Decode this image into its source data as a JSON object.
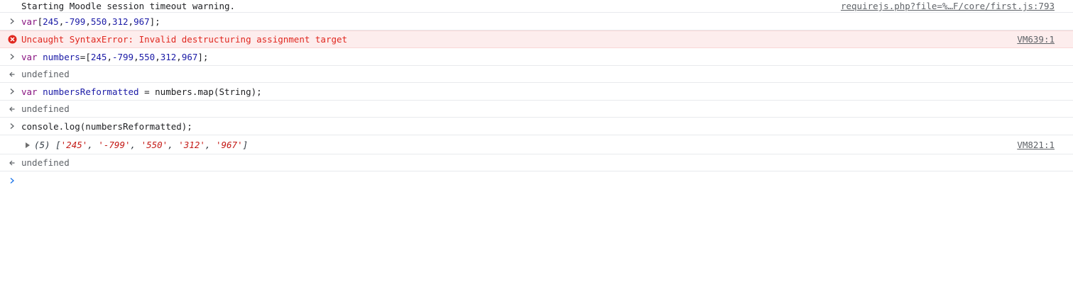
{
  "console": {
    "entries": [
      {
        "kind": "log",
        "text": "Starting Moodle session timeout warning.",
        "source": "requirejs.php?file=%…F/core/first.js:793"
      },
      {
        "kind": "input",
        "text_parts": [
          "var",
          "[",
          "245",
          ",",
          "-799",
          ",",
          "550",
          ",",
          "312",
          ",",
          "967",
          "];"
        ]
      },
      {
        "kind": "error",
        "icon": "error-circle-icon",
        "text": "Uncaught SyntaxError: Invalid destructuring assignment target",
        "source": "VM639:1"
      },
      {
        "kind": "input",
        "text_parts": [
          "var",
          " ",
          "numbers",
          "=[",
          "245",
          ",",
          "-799",
          ",",
          "550",
          ",",
          "312",
          ",",
          "967",
          "];"
        ]
      },
      {
        "kind": "result",
        "text": "undefined"
      },
      {
        "kind": "input",
        "text_parts": [
          "var",
          " ",
          "numbersReformatted",
          " = numbers.map(String);"
        ]
      },
      {
        "kind": "result",
        "text": "undefined"
      },
      {
        "kind": "input",
        "text": "console.log(numbersReformatted);"
      },
      {
        "kind": "array-log",
        "count": "(5)",
        "open": "[",
        "items": [
          "'245'",
          "'-799'",
          "'550'",
          "'312'",
          "'967'"
        ],
        "close": "]",
        "source": "VM821:1"
      },
      {
        "kind": "result",
        "text": "undefined"
      }
    ],
    "prompt": {
      "icon": "prompt-chevron-icon",
      "value": ""
    },
    "colors": {
      "keyword": "#881280",
      "number": "#1a1aa6",
      "string": "#c41a16",
      "error_text": "#e0271f",
      "error_bg": "#fdeded",
      "prompt_accent": "#1a73e8"
    }
  }
}
